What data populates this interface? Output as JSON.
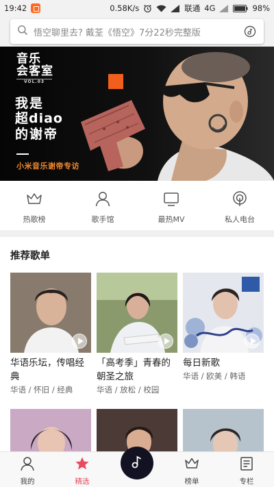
{
  "status_bar": {
    "time": "19:42",
    "net_speed": "0.58K/s",
    "carrier": "联通",
    "network": "4G",
    "battery": "98%"
  },
  "search": {
    "placeholder": "悟空聊里去? 戴荃《悟空》7分22秒完整版"
  },
  "banner": {
    "logo_line1": "音乐",
    "logo_line2": "会客室",
    "logo_line3": "VOL.03",
    "headline_line1": "我是",
    "headline_line2": "超diao",
    "headline_line3": "的谢帝",
    "subtitle": "小米音乐谢帝专访"
  },
  "shortcuts": [
    {
      "label": "热歌榜",
      "icon": "crown-icon"
    },
    {
      "label": "歌手馆",
      "icon": "singer-icon"
    },
    {
      "label": "最热MV",
      "icon": "tv-icon"
    },
    {
      "label": "私人电台",
      "icon": "radio-icon"
    }
  ],
  "section": {
    "title": "推荐歌单"
  },
  "playlists": [
    {
      "title": "华语乐坛，传唱经典",
      "tags": "华语 / 怀旧 / 经典",
      "cover_color": "#6b5a4a"
    },
    {
      "title": "「高考季」青春的朝圣之旅",
      "tags": "华语 / 放松 / 校园",
      "cover_color": "#6f7a5a"
    },
    {
      "title": "每日新歌",
      "tags": "华语 / 欧美 / 韩语",
      "cover_color": "#d8dde6"
    },
    {
      "title": "",
      "tags": "",
      "cover_color": "#c9a9c4"
    },
    {
      "title": "",
      "tags": "",
      "cover_color": "#4b3a35"
    },
    {
      "title": "",
      "tags": "",
      "cover_color": "#b7c3cc"
    }
  ],
  "bottom_nav": [
    {
      "label": "我的",
      "icon": "user-icon"
    },
    {
      "label": "精选",
      "icon": "star-icon"
    },
    {
      "label": "榜单",
      "icon": "crown-icon"
    },
    {
      "label": "专栏",
      "icon": "column-icon"
    }
  ],
  "colors": {
    "accent": "#e94a62",
    "banner_orange": "#f28a2f",
    "play_button": "#121223"
  }
}
